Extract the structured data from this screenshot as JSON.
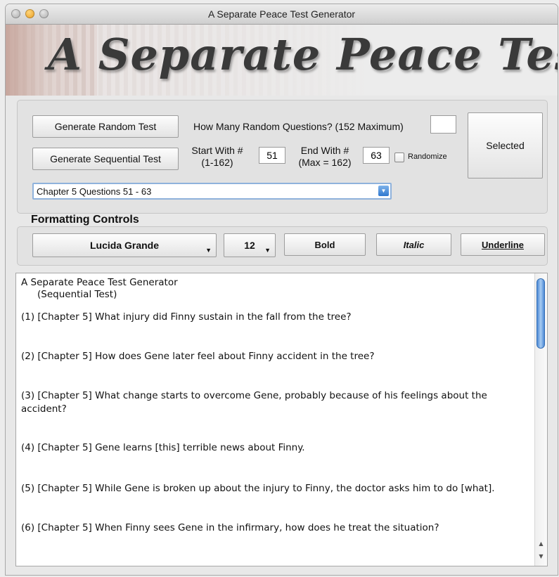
{
  "window": {
    "title": "A Separate Peace Test Generator"
  },
  "banner": {
    "title": "A Separate Peace Test Generator"
  },
  "controls": {
    "random_button": "Generate Random Test",
    "random_count_label": "How Many Random Questions? (152 Maximum)",
    "random_count_value": "",
    "selected_button": "Selected",
    "sequential_button": "Generate Sequential Test",
    "start_label_line1": "Start With #",
    "start_label_line2": "(1-162)",
    "start_value": "51",
    "end_label_line1": "End With #",
    "end_label_line2": "(Max = 162)",
    "end_value": "63",
    "randomize_label": "Randomize",
    "randomize_checked": false,
    "chapter_select_value": "Chapter 5  Questions 51 - 63"
  },
  "formatting": {
    "title": "Formatting Controls",
    "font_name": "Lucida Grande",
    "font_size": "12",
    "bold_label": "Bold",
    "italic_label": "Italic",
    "underline_label": "Underline"
  },
  "document": {
    "heading": "A Separate Peace Test Generator",
    "subheading": "(Sequential Test)",
    "questions": [
      "(1)  [Chapter 5]  What injury did Finny sustain in the fall from the tree?",
      "(2)  [Chapter 5]  How does Gene later feel about Finny accident in the tree?",
      "(3)  [Chapter 5]  What change starts to overcome Gene, probably because of his feelings about the accident?",
      "(4)  [Chapter 5]  Gene learns [this] terrible news about Finny.",
      "(5)  [Chapter 5]  While Gene is broken up about the injury to Finny, the doctor asks him to do [what].",
      "(6)  [Chapter 5]  When Finny sees Gene in the infirmary, how does he treat the situation?"
    ]
  },
  "colors": {
    "accent": "#2f78d0",
    "focus_ring": "#8fb2dc"
  }
}
